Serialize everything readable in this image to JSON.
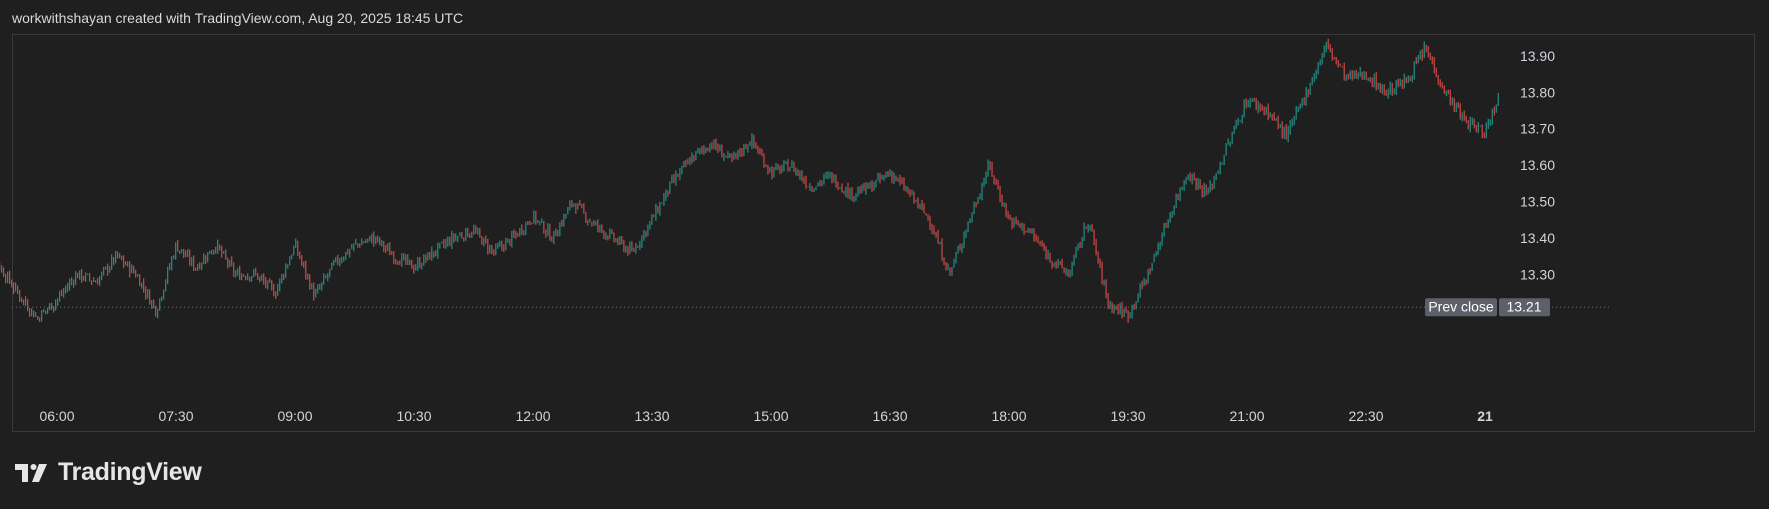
{
  "header": {
    "text": "workwithshayan created with TradingView.com, Aug 20, 2025 18:45 UTC"
  },
  "branding": {
    "logo_text": "TradingView",
    "logo_icon": "tradingview-logo-icon"
  },
  "colors": {
    "background": "#1f1f1f",
    "up": "#26a69a",
    "down": "#ef5350",
    "text": "#d1d4dc",
    "label_bg": "#5d606b"
  },
  "chart_data": {
    "type": "candlestick",
    "x_tick_labels": [
      "06:00",
      "07:30",
      "09:00",
      "10:30",
      "12:00",
      "13:30",
      "15:00",
      "16:30",
      "18:00",
      "19:30",
      "21:00",
      "22:30",
      "21"
    ],
    "y_tick_labels": [
      "13.30",
      "13.40",
      "13.50",
      "13.60",
      "13.70",
      "13.80",
      "13.90"
    ],
    "y_ticks": [
      13.3,
      13.4,
      13.5,
      13.6,
      13.7,
      13.8,
      13.9
    ],
    "ylim": [
      13.17,
      14.0
    ],
    "prev_close": {
      "label": "Prev close",
      "value": "13.21"
    },
    "close_path": [
      [
        "05:00",
        13.22
      ],
      [
        "05:15",
        13.33
      ],
      [
        "05:30",
        13.25
      ],
      [
        "05:45",
        13.18
      ],
      [
        "06:00",
        13.23
      ],
      [
        "06:15",
        13.3
      ],
      [
        "06:30",
        13.28
      ],
      [
        "06:45",
        13.35
      ],
      [
        "07:00",
        13.3
      ],
      [
        "07:15",
        13.2
      ],
      [
        "07:30",
        13.38
      ],
      [
        "07:45",
        13.32
      ],
      [
        "08:00",
        13.38
      ],
      [
        "08:15",
        13.3
      ],
      [
        "08:30",
        13.3
      ],
      [
        "08:45",
        13.25
      ],
      [
        "09:00",
        13.38
      ],
      [
        "09:15",
        13.24
      ],
      [
        "09:30",
        13.33
      ],
      [
        "09:45",
        13.38
      ],
      [
        "10:00",
        13.4
      ],
      [
        "10:15",
        13.35
      ],
      [
        "10:30",
        13.32
      ],
      [
        "10:45",
        13.36
      ],
      [
        "11:00",
        13.4
      ],
      [
        "11:15",
        13.42
      ],
      [
        "11:30",
        13.36
      ],
      [
        "11:45",
        13.4
      ],
      [
        "12:00",
        13.46
      ],
      [
        "12:15",
        13.4
      ],
      [
        "12:30",
        13.5
      ],
      [
        "12:45",
        13.44
      ],
      [
        "13:00",
        13.4
      ],
      [
        "13:15",
        13.36
      ],
      [
        "13:30",
        13.45
      ],
      [
        "13:45",
        13.55
      ],
      [
        "14:00",
        13.62
      ],
      [
        "14:15",
        13.66
      ],
      [
        "14:30",
        13.61
      ],
      [
        "14:45",
        13.67
      ],
      [
        "15:00",
        13.58
      ],
      [
        "15:15",
        13.6
      ],
      [
        "15:30",
        13.54
      ],
      [
        "15:45",
        13.57
      ],
      [
        "16:00",
        13.52
      ],
      [
        "16:15",
        13.54
      ],
      [
        "16:30",
        13.58
      ],
      [
        "16:45",
        13.52
      ],
      [
        "17:00",
        13.45
      ],
      [
        "17:15",
        13.3
      ],
      [
        "17:30",
        13.45
      ],
      [
        "17:45",
        13.6
      ],
      [
        "18:00",
        13.45
      ],
      [
        "18:15",
        13.42
      ],
      [
        "18:30",
        13.35
      ],
      [
        "18:45",
        13.3
      ],
      [
        "19:00",
        13.45
      ],
      [
        "19:15",
        13.22
      ],
      [
        "19:30",
        13.19
      ],
      [
        "19:45",
        13.3
      ],
      [
        "20:00",
        13.45
      ],
      [
        "20:15",
        13.58
      ],
      [
        "20:30",
        13.52
      ],
      [
        "20:45",
        13.65
      ],
      [
        "21:00",
        13.78
      ],
      [
        "21:15",
        13.75
      ],
      [
        "21:30",
        13.68
      ],
      [
        "21:45",
        13.8
      ],
      [
        "22:00",
        13.93
      ],
      [
        "22:15",
        13.84
      ],
      [
        "22:30",
        13.85
      ],
      [
        "22:45",
        13.8
      ],
      [
        "23:00",
        13.83
      ],
      [
        "23:15",
        13.92
      ],
      [
        "23:30",
        13.8
      ],
      [
        "23:45",
        13.72
      ],
      [
        "00:00",
        13.69
      ],
      [
        "00:10",
        13.79
      ]
    ]
  }
}
